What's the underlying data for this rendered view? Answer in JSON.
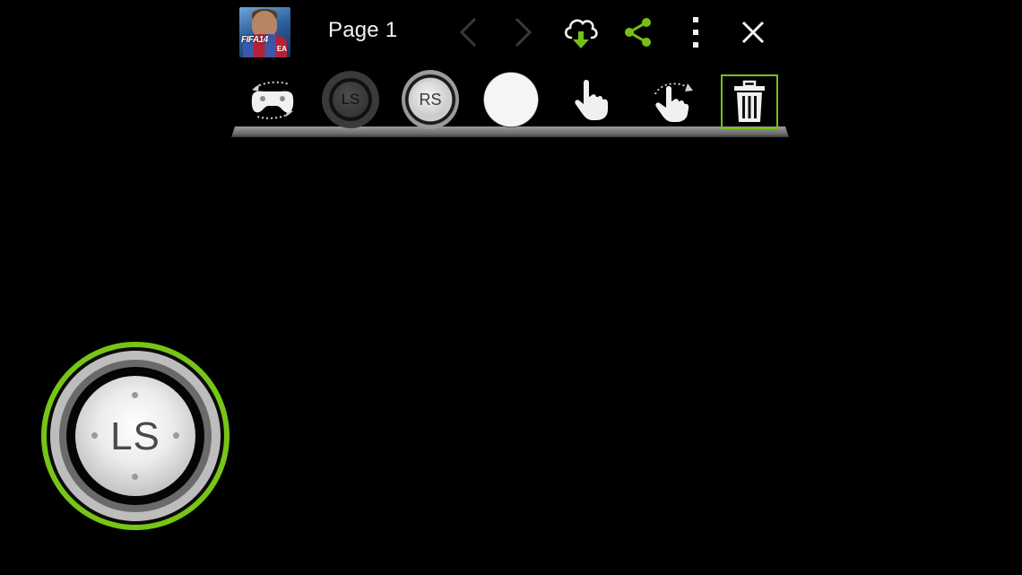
{
  "header": {
    "game_icon": {
      "name": "fifa-14-cover-icon",
      "logo_text": "FIFA14",
      "publisher_text": "EA"
    },
    "page_label": "Page 1",
    "buttons": {
      "prev": "chevron-left-icon",
      "next": "chevron-right-icon",
      "download": "cloud-download-icon",
      "share": "share-icon",
      "more": "more-vertical-icon",
      "close": "close-icon"
    }
  },
  "toolbar": {
    "tools": [
      {
        "id": "rotate-controller",
        "icon": "rotate-controller-icon"
      },
      {
        "id": "left-stick",
        "label": "LS"
      },
      {
        "id": "right-stick",
        "label": "RS"
      },
      {
        "id": "button",
        "icon": "round-button-icon"
      },
      {
        "id": "tap",
        "icon": "tap-hand-icon"
      },
      {
        "id": "swipe",
        "icon": "swipe-hand-icon"
      },
      {
        "id": "delete",
        "icon": "trash-icon",
        "selected": true
      }
    ],
    "ls_label": "LS",
    "rs_label": "RS"
  },
  "canvas": {
    "control": {
      "type": "left-stick",
      "label": "LS",
      "selected": true
    }
  },
  "colors": {
    "accent": "#76c016",
    "background": "#000000",
    "icon_light": "#f2f2f2",
    "nav_disabled": "#3a3a3a"
  }
}
